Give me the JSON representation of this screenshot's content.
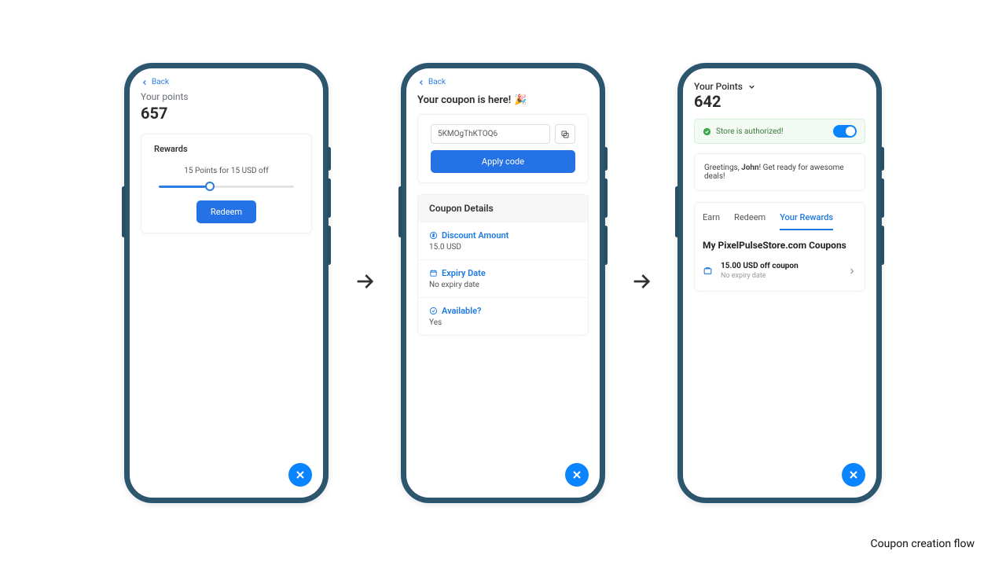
{
  "caption": "Coupon creation flow",
  "phone1": {
    "back": "Back",
    "points_label": "Your points",
    "points_value": "657",
    "rewards_title": "Rewards",
    "slider_text": "15 Points for 15 USD off",
    "slider_pct": 38,
    "redeem_label": "Redeem"
  },
  "phone2": {
    "back": "Back",
    "headline": "Your coupon is here!",
    "emoji": "🎉",
    "code": "5KMOgThKTOQ6",
    "apply_label": "Apply code",
    "details_title": "Coupon Details",
    "discount_label": "Discount Amount",
    "discount_value": "15.0 USD",
    "expiry_label": "Expiry Date",
    "expiry_value": "No expiry date",
    "available_label": "Available?",
    "available_value": "Yes"
  },
  "phone3": {
    "points_label": "Your Points",
    "points_value": "642",
    "auth_text": "Store is authorized!",
    "greet_prefix": "Greetings, ",
    "greet_name": "John",
    "greet_suffix": "! Get ready for awesome deals!",
    "tabs": {
      "earn": "Earn",
      "redeem": "Redeem",
      "rewards": "Your Rewards"
    },
    "coupons_title": "My PixelPulseStore.com Coupons",
    "coupon_item_title": "15.00 USD off coupon",
    "coupon_item_sub": "No expiry date"
  }
}
